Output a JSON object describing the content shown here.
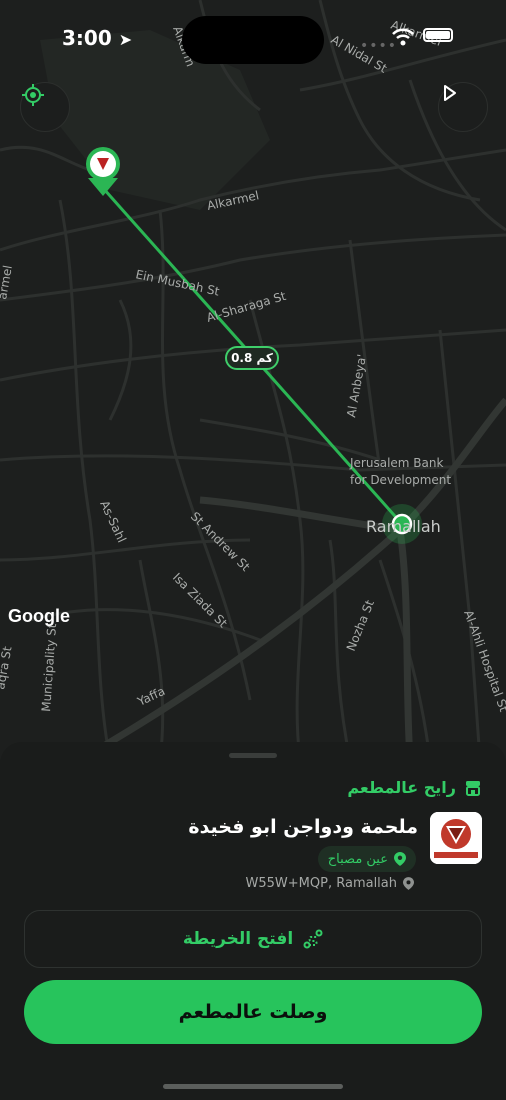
{
  "status_bar": {
    "time": "3:00"
  },
  "map": {
    "google_label": "Google",
    "distance_badge": "0.8 كم",
    "city_label": "Ramallah",
    "street_labels": {
      "alkarmel_top": "Alkarmel",
      "al_nidal": "Al Nidal St",
      "alkarmel": "Alkarmel",
      "ein_musbah": "Ein Musbah St",
      "al_sharaga": "Al-Sharaga St",
      "al_anbeya": "Al Anbeya'",
      "jerusalem_bank_1": "Jerusalem Bank",
      "jerusalem_bank_2": "for Development",
      "as_sahl": "As-Sahl",
      "st_andrew": "St Andrew St",
      "isa_ziada": "Isa Ziada St",
      "municipality": "Municipality St",
      "yaffa": "Yaffa",
      "nozha": "Nozha St",
      "al_ahli": "Al-Ahli Hospital St",
      "armel_left": "armel",
      "aqra_left": "aqra St",
      "alkarm_top": "Alkarm"
    }
  },
  "sheet": {
    "going_label": "رايح عالمطعم",
    "restaurant_name": "ملحمة ودواجن ابو فخيدة",
    "area": "عين مصباح",
    "address": "W55W+MQP, Ramallah",
    "open_map_label": "افتح الخريطة",
    "arrived_label": "وصلت عالمطعم"
  },
  "colors": {
    "accent": "#27c45c",
    "map_bg": "#1d1f1e",
    "sheet_bg": "#1a1c1b"
  }
}
